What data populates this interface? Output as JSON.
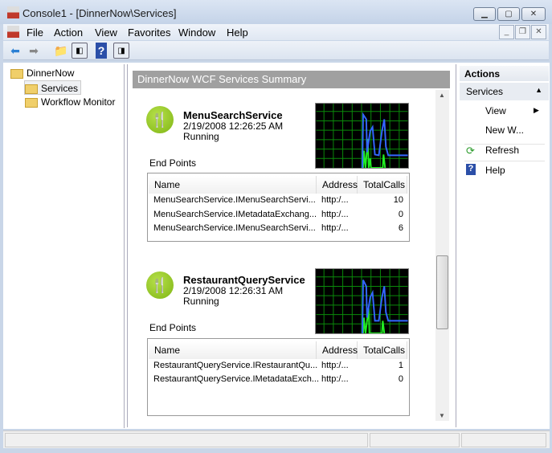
{
  "window": {
    "title": "Console1 - [DinnerNow\\Services]"
  },
  "menu": [
    "File",
    "Action",
    "View",
    "Favorites",
    "Window",
    "Help"
  ],
  "tree": {
    "root": "DinnerNow",
    "items": [
      "Services",
      "Workflow Monitor"
    ]
  },
  "center": {
    "header": "DinnerNow WCF Services Summary",
    "endpoints_label": "End Points",
    "columns": [
      "Name",
      "Address",
      "TotalCalls"
    ],
    "services": [
      {
        "name": "MenuSearchService",
        "date": "2/19/2008 12:26:25 AM",
        "status": "Running",
        "rows": [
          [
            "MenuSearchService.IMenuSearchServi...",
            "http:/...",
            "10"
          ],
          [
            "MenuSearchService.IMetadataExchang...",
            "http:/...",
            "0"
          ],
          [
            "MenuSearchService.IMenuSearchServi...",
            "http:/...",
            "6"
          ]
        ]
      },
      {
        "name": "RestaurantQueryService",
        "date": "2/19/2008 12:26:31 AM",
        "status": "Running",
        "rows": [
          [
            "RestaurantQueryService.IRestaurantQu...",
            "http:/...",
            "1"
          ],
          [
            "RestaurantQueryService.IMetadataExch...",
            "http:/...",
            "0"
          ]
        ]
      }
    ]
  },
  "actions": {
    "header": "Actions",
    "section": "Services",
    "items": [
      "View",
      "New W...",
      "Refresh",
      "Help"
    ]
  }
}
